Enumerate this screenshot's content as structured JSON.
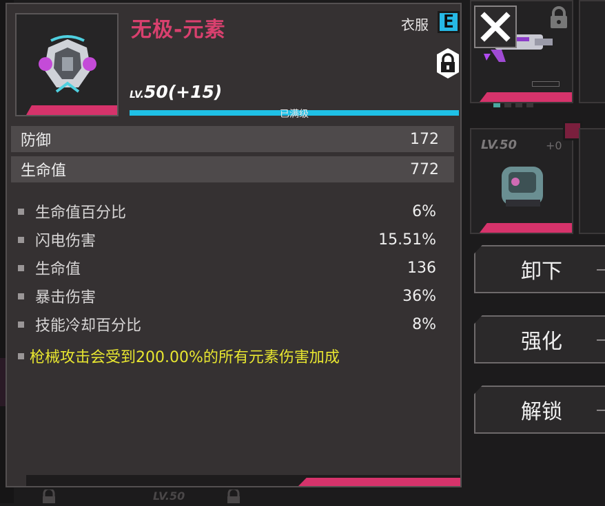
{
  "item": {
    "name": "无极-元素",
    "slot": "衣服",
    "rarity": "E",
    "level_prefix": "LV.",
    "level": "50(+15)",
    "level_status": "已满级",
    "level_progress": 1.0
  },
  "main_stats": [
    {
      "label": "防御",
      "value": "172"
    },
    {
      "label": "生命值",
      "value": "772"
    }
  ],
  "sub_stats": [
    {
      "label": "生命值百分比",
      "value": "6%"
    },
    {
      "label": "闪电伤害",
      "value": "15.51%"
    },
    {
      "label": "生命值",
      "value": "136"
    },
    {
      "label": "暴击伤害",
      "value": "36%"
    },
    {
      "label": "技能冷却百分比",
      "value": "8%"
    }
  ],
  "special_effect": "枪械攻击会受到200.00%的所有元素伤害加成",
  "actions": {
    "unequip": "卸下",
    "enhance": "强化",
    "unlock": "解锁"
  },
  "side_card": {
    "level": "LV.50",
    "plus": "+0"
  },
  "bottom_card": {
    "level": "LV.50"
  },
  "icons": {
    "close": "close-icon",
    "lock": "lock-icon"
  },
  "colors": {
    "accent_pink": "#d6336b",
    "rarity_blue": "#26b9e6",
    "special_yellow": "#e8e630"
  }
}
